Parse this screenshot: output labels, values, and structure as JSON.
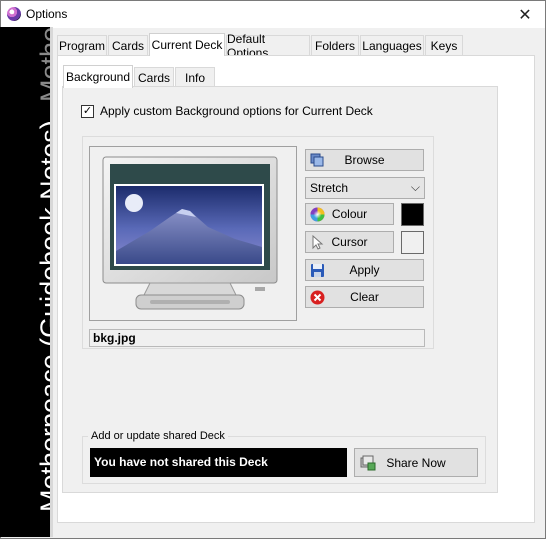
{
  "window": {
    "title": "Options",
    "close_glyph": "✕"
  },
  "sidebar": {
    "main_text": "Motherpeace (Guidebook Notes)",
    "ghost_text": "Motherpeace"
  },
  "main_tabs": [
    "Program",
    "Cards",
    "Current Deck",
    "Default Options",
    "Folders",
    "Languages",
    "Keys"
  ],
  "main_tabs_active": "Current Deck",
  "sub_tabs": [
    "Background",
    "Cards",
    "Info"
  ],
  "sub_tabs_active": "Background",
  "background": {
    "apply_custom_checked": true,
    "apply_custom_label": "Apply custom Background options for Current Deck",
    "check_glyph": "✓",
    "browse_label": "Browse",
    "stretch_value": "Stretch",
    "select_arrow": "⌵",
    "colour_label": "Colour",
    "colour_value": "#000000",
    "cursor_label": "Cursor",
    "cursor_colour_value": "#f0f0f0",
    "apply_label": "Apply",
    "clear_label": "Clear",
    "file_name": "bkg.jpg"
  },
  "shared": {
    "legend": "Add or update shared Deck",
    "status": "You have not shared this Deck",
    "share_button": "Share Now"
  },
  "icons": {
    "app": "motherpeace-app-icon",
    "browse": "browse-images-icon",
    "colour": "colour-wheel-icon",
    "cursor": "cursor-arrow-icon",
    "apply": "floppy-disk-icon",
    "clear": "red-x-icon",
    "share": "share-deck-icon"
  }
}
